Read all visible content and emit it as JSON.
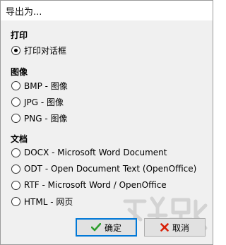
{
  "window": {
    "title": "导出为..."
  },
  "sections": {
    "print": {
      "label": "打印",
      "options": [
        {
          "label": "打印对话框",
          "checked": true
        }
      ]
    },
    "image": {
      "label": "图像",
      "options": [
        {
          "label": "BMP - 图像",
          "checked": false
        },
        {
          "label": "JPG - 图像",
          "checked": false
        },
        {
          "label": "PNG - 图像",
          "checked": false
        }
      ]
    },
    "document": {
      "label": "文档",
      "options": [
        {
          "label": "DOCX - Microsoft Word Document",
          "checked": false
        },
        {
          "label": "ODT - Open Document Text (OpenOffice)",
          "checked": false
        },
        {
          "label": "RTF - Microsoft Word / OpenOffice",
          "checked": false
        },
        {
          "label": "HTML - 网页",
          "checked": false
        }
      ]
    }
  },
  "buttons": {
    "ok": {
      "label": "确定",
      "icon": "checkmark-icon",
      "color": "#2e9e2e"
    },
    "cancel": {
      "label": "取消",
      "icon": "cross-icon",
      "color": "#d81e06"
    }
  },
  "watermark": {
    "icon": "site-watermark-logo"
  }
}
